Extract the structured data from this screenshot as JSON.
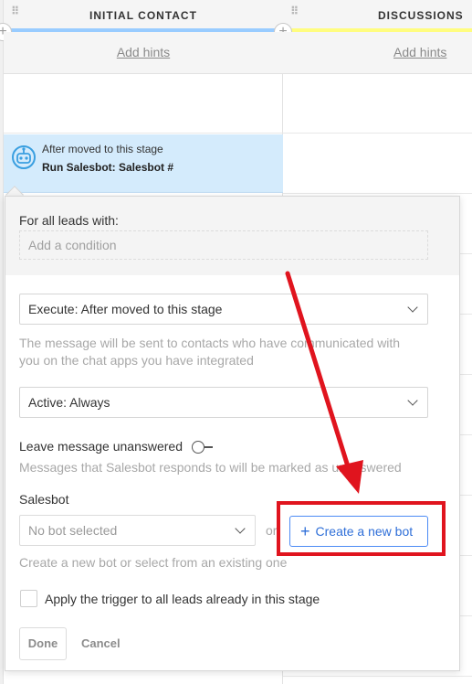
{
  "columns": [
    {
      "title": "INITIAL CONTACT",
      "hints_label": "Add hints",
      "color": "#99ccff"
    },
    {
      "title": "DISCUSSIONS",
      "hints_label": "Add hints",
      "color": "#fffd7f"
    }
  ],
  "trigger": {
    "subtitle": "After moved to this stage",
    "title": "Run Salesbot: Salesbot #",
    "icon": "robot-icon"
  },
  "popup": {
    "condition_label": "For all leads with:",
    "condition_placeholder": "Add a condition",
    "execute_select": "Execute: After moved to this stage",
    "execute_help": "The message will be sent to contacts who have communicated with you on the chat apps you have integrated",
    "active_select": "Active: Always",
    "leave_label": "Leave message unanswered",
    "leave_help": "Messages that Salesbot responds to will be marked as unanswered",
    "salesbot_label": "Salesbot",
    "bot_select_placeholder": "No bot selected",
    "or_label": "or",
    "create_button_label": "Create a new bot",
    "create_help": "Create a new bot or select from an existing one",
    "apply_all_label": "Apply the trigger to all leads already in this stage",
    "done_label": "Done",
    "cancel_label": "Cancel"
  },
  "annotation": {
    "highlight_color": "#e0141e",
    "arrow_color": "#e0141e"
  }
}
